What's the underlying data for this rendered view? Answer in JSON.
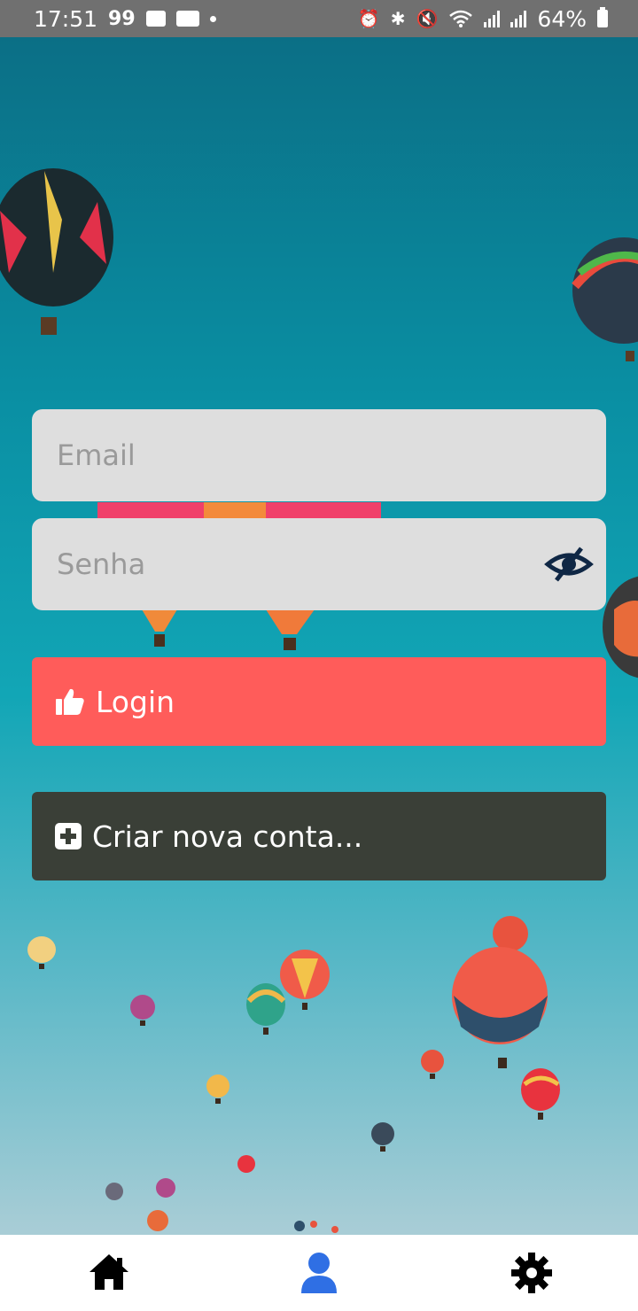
{
  "status_bar": {
    "time": "17:51",
    "notification_badge": "99",
    "battery": "64%",
    "icons": [
      "message-icon",
      "youtube-icon",
      "dot-icon",
      "alarm-icon",
      "bluetooth-icon",
      "mute-icon",
      "wifi-icon",
      "signal-icon",
      "signal-icon",
      "battery-icon"
    ]
  },
  "login_form": {
    "email_placeholder": "Email",
    "email_value": "",
    "password_placeholder": "Senha",
    "password_value": "",
    "password_toggle_icon": "eye-slash-icon",
    "login_label": "Login",
    "login_icon": "thumbs-up-icon",
    "create_account_label": "Criar nova conta...",
    "create_account_icon": "plus-square-icon"
  },
  "colors": {
    "login_button": "#ff5c5a",
    "create_button": "#3a3f37",
    "active_tab": "#2f6fe4",
    "inactive_tab": "#000000"
  },
  "bottom_nav": {
    "items": [
      {
        "name": "home-icon",
        "active": false
      },
      {
        "name": "user-icon",
        "active": true
      },
      {
        "name": "settings-icon",
        "active": false
      }
    ]
  }
}
